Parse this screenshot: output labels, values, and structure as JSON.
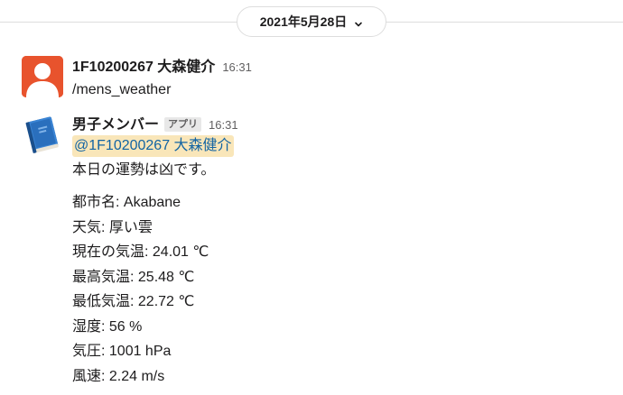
{
  "date_divider": {
    "label": "2021年5月28日"
  },
  "messages": [
    {
      "sender": "1F10200267 大森健介",
      "time": "16:31",
      "text": "/mens_weather",
      "avatar_color": "#e8532d"
    },
    {
      "sender": "男子メンバー",
      "badge": "アプリ",
      "time": "16:31",
      "mention": "@1F10200267 大森健介",
      "intro": "本日の運勢は凶です。",
      "weather_lines": [
        "都市名: Akabane",
        "天気: 厚い雲",
        "現在の気温: 24.01 ℃",
        "最高気温: 25.48 ℃",
        "最低気温: 22.72 ℃",
        "湿度: 56 %",
        "気圧: 1001 hPa",
        "風速: 2.24 m/s"
      ]
    }
  ],
  "colors": {
    "mention_bg": "#f9e6b9",
    "mention_text": "#1264a3",
    "user_avatar": "#e8532d"
  },
  "icons": {
    "date_chevron": "chevron-down-icon",
    "user_avatar": "user-silhouette-icon",
    "bot_avatar": "notebook-icon"
  }
}
